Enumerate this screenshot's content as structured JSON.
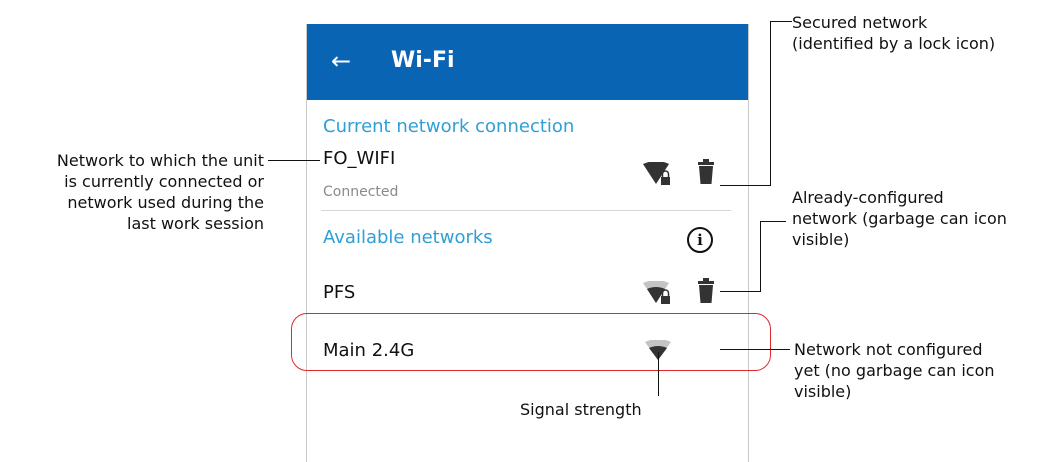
{
  "appbar": {
    "title": "Wi-Fi",
    "back_icon": "arrow-left-icon"
  },
  "current": {
    "section_label": "Current network connection",
    "network": {
      "name": "FO_WIFI",
      "status": "Connected",
      "secured": true,
      "signal": "strong"
    }
  },
  "available": {
    "section_label": "Available networks",
    "networks": [
      {
        "name": "PFS",
        "secured": true,
        "configured": true,
        "signal": "medium"
      },
      {
        "name": "Main 2.4G",
        "secured": false,
        "configured": false,
        "signal": "medium"
      }
    ]
  },
  "annotations": {
    "connected_network": [
      "Network to which the unit",
      "is currently connected or",
      "network used during the",
      "last work session"
    ],
    "secured": [
      "Secured network",
      "(identified by a lock icon)"
    ],
    "configured": [
      "Already-configured",
      "network (garbage can icon",
      "visible)"
    ],
    "not_configured": [
      "Network not configured",
      "yet (no garbage can icon",
      "visible)"
    ],
    "signal": "Signal strength"
  },
  "colors": {
    "appbar": "#0a64b4",
    "section": "#2f9fd6",
    "highlight": "#e0282c"
  }
}
